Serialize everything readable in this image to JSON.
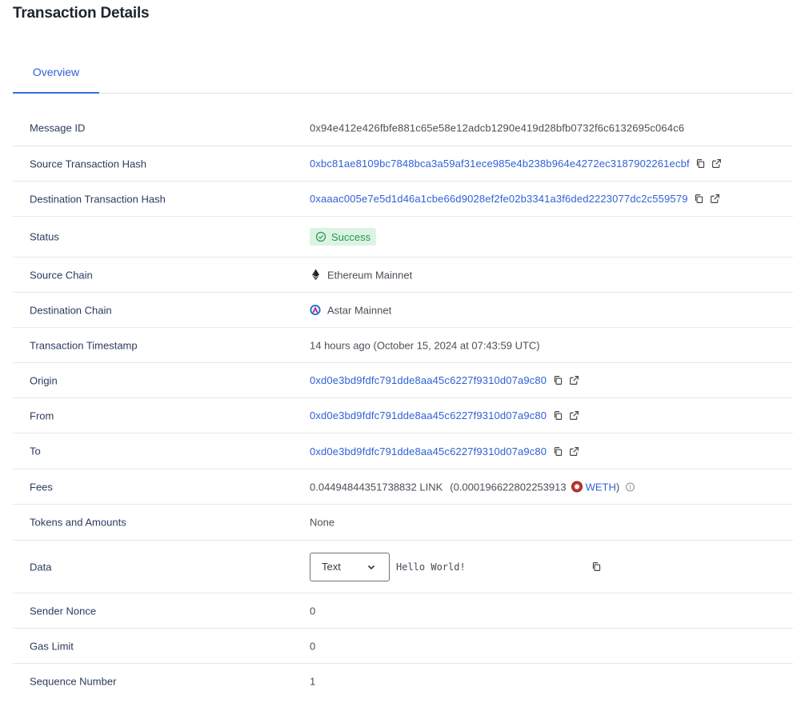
{
  "header": {
    "title": "Transaction Details"
  },
  "tabs": [
    {
      "label": "Overview",
      "active": true
    }
  ],
  "colors": {
    "accent": "#2f62d6",
    "success_bg": "#dcf3e4",
    "success_text": "#1f9a4f",
    "label": "#2c3a5e",
    "divider": "#e5e8ec"
  },
  "details": {
    "message_id": {
      "label": "Message ID",
      "value": "0x94e412e426fbfe881c65e58e12adcb1290e419d28bfb0732f6c6132695c064c6"
    },
    "source_tx_hash": {
      "label": "Source Transaction Hash",
      "value": "0xbc81ae8109bc7848bca3a59af31ece985e4b238b964e4272ec3187902261ecbf",
      "icons": [
        "copy-icon",
        "external-link-icon"
      ]
    },
    "dest_tx_hash": {
      "label": "Destination Transaction Hash",
      "value": "0xaaac005e7e5d1d46a1cbe66d9028ef2fe02b3341a3f6ded2223077dc2c559579",
      "icons": [
        "copy-icon",
        "external-link-icon"
      ]
    },
    "status": {
      "label": "Status",
      "value": "Success",
      "icon": "check-circle-icon"
    },
    "source_chain": {
      "label": "Source Chain",
      "value": "Ethereum Mainnet",
      "icon": "ethereum-icon"
    },
    "dest_chain": {
      "label": "Destination Chain",
      "value": "Astar Mainnet",
      "icon": "astar-icon"
    },
    "timestamp": {
      "label": "Transaction Timestamp",
      "value": "14 hours ago (October 15, 2024 at 07:43:59 UTC)"
    },
    "origin": {
      "label": "Origin",
      "value": "0xd0e3bd9fdfc791dde8aa45c6227f9310d07a9c80"
    },
    "from": {
      "label": "From",
      "value": "0xd0e3bd9fdfc791dde8aa45c6227f9310d07a9c80"
    },
    "to": {
      "label": "To",
      "value": "0xd0e3bd9fdfc791dde8aa45c6227f9310d07a9c80"
    },
    "fees": {
      "label": "Fees",
      "value": "0.04494844351738832 LINK",
      "converted_prefix": "(0.000196622802253913",
      "token": "WETH",
      "converted_suffix": ")",
      "icon": "weth-icon"
    },
    "tokens": {
      "label": "Tokens and Amounts",
      "value": "None"
    },
    "data": {
      "label": "Data",
      "format_selected": "Text",
      "value": "Hello World!"
    },
    "sender_nonce": {
      "label": "Sender Nonce",
      "value": "0"
    },
    "gas_limit": {
      "label": "Gas Limit",
      "value": "0"
    },
    "sequence_number": {
      "label": "Sequence Number",
      "value": "1"
    }
  }
}
